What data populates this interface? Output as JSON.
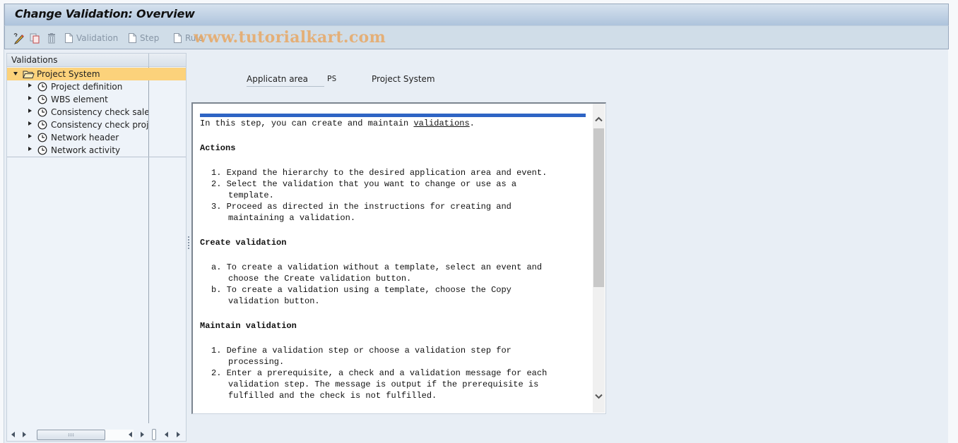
{
  "window": {
    "title": "Change Validation: Overview"
  },
  "toolbar": {
    "items": [
      {
        "icon": "edit-pencil-icon",
        "label": ""
      },
      {
        "icon": "copy-icon",
        "label": ""
      },
      {
        "icon": "delete-trash-icon",
        "label": ""
      },
      {
        "icon": "new-document-icon",
        "label": "Validation"
      },
      {
        "icon": "new-document-icon",
        "label": "Step"
      },
      {
        "icon": "new-document-icon",
        "label": "Rule"
      }
    ],
    "watermark": "www.tutorialkart.com"
  },
  "tree": {
    "header": "Validations",
    "root": {
      "label": "Project System",
      "icon": "folder-open-icon",
      "expanded": true,
      "selected": true
    },
    "children": [
      {
        "label": "Project definition",
        "icon": "clock-icon"
      },
      {
        "label": "WBS element",
        "icon": "clock-icon"
      },
      {
        "label": "Consistency check sales d",
        "icon": "clock-icon"
      },
      {
        "label": "Consistency check projec",
        "icon": "clock-icon"
      },
      {
        "label": "Network header",
        "icon": "clock-icon"
      },
      {
        "label": "Network activity",
        "icon": "clock-icon"
      }
    ]
  },
  "application_area": {
    "label": "Applicatn area",
    "code": "PS",
    "description": "Project System"
  },
  "documentation": {
    "intro_prefix": "In this step, you can create and maintain ",
    "intro_link": "validations",
    "intro_suffix": ".",
    "sections": [
      {
        "heading": "Actions",
        "items": [
          {
            "marker": "1.",
            "lines": [
              "Expand the hierarchy to the desired application area and event."
            ]
          },
          {
            "marker": "2.",
            "lines": [
              "Select the validation that you want to change or use as a",
              "template."
            ]
          },
          {
            "marker": "3.",
            "lines": [
              "Proceed as directed in the instructions for creating and",
              "maintaining a validation."
            ]
          }
        ]
      },
      {
        "heading": "Create validation",
        "items": [
          {
            "marker": "a.",
            "lines": [
              "To create a validation without a template, select an event and",
              "choose the Create validation button."
            ]
          },
          {
            "marker": "b.",
            "lines": [
              "To create a validation using a template, choose the Copy",
              "validation button."
            ]
          }
        ]
      },
      {
        "heading": "Maintain validation",
        "items": [
          {
            "marker": "1.",
            "lines": [
              "Define a validation step or choose a validation step for",
              "processing."
            ]
          },
          {
            "marker": "2.",
            "lines": [
              "Enter a prerequisite, a check and a validation message for each",
              "validation step. The message is output if the prerequisite is",
              "fulfilled and the check is not fulfilled."
            ]
          }
        ]
      }
    ]
  },
  "colors": {
    "selection": "#fcd27b",
    "doc_bar": "#2e64c4",
    "title_gradient_top": "#d6e2ee",
    "title_gradient_bottom": "#aec4dc",
    "toolbar_bg": "#d0dde8",
    "background": "#e8eef5"
  }
}
